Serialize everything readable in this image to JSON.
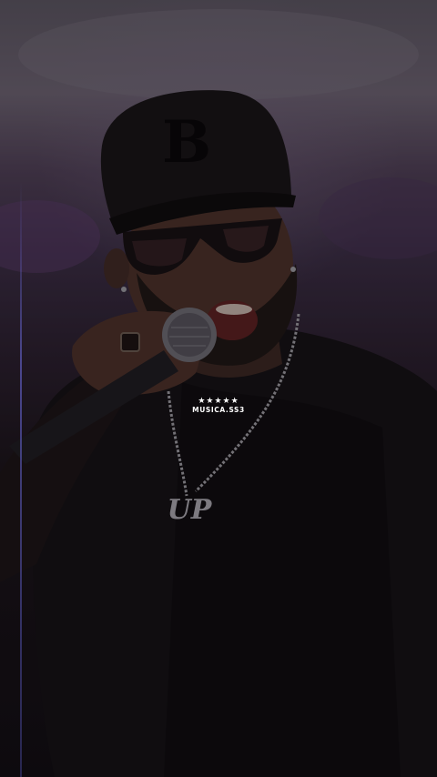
{
  "scene": {
    "subject": "performer-singing",
    "cap_logo_letter": "B",
    "pendant_text": "UP"
  },
  "watermark": {
    "stars": "★★★★★",
    "text": "MUSICA.SS3"
  },
  "colors": {
    "background_top": "#6b6270",
    "background_bottom": "#0f0c10",
    "side_line": "#6e6ee6",
    "watermark_text": "#ffffff"
  }
}
